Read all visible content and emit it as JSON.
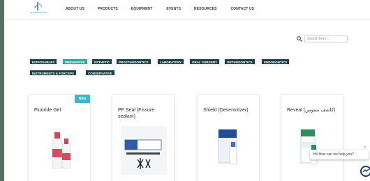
{
  "header": {
    "logo_text": "Al Hassan Dental",
    "nav": [
      "ABOUT US",
      "PRODUCTS",
      "EQUIPMENT",
      "EVENTS",
      "RESOURCES",
      "CONTACT US"
    ]
  },
  "search": {
    "placeholder": "Search here..."
  },
  "tabs": [
    "DISPOSABLES",
    "PREVENTIVE",
    "ESTHETIC",
    "PROSTHODONTICS",
    "LABORATORY",
    "ORAL SURGERY",
    "ORTHODONTICS",
    "ENDODONTICS",
    "INSTRUMENTS & FORCEPS",
    "CONSERVATIVE"
  ],
  "active_tab": "PREVENTIVE",
  "products": [
    {
      "title": "Fluoride Gel",
      "badge": "New"
    },
    {
      "title": "PF Seal (Fissure sealant)"
    },
    {
      "title": "Shield (Desensitizer)"
    },
    {
      "title": "Reveal (كاشف تسوس)"
    }
  ],
  "chat": {
    "prompt": "Hi! How can we help you?",
    "close": "×"
  },
  "colors": {
    "tab_bg": "#1c3f48",
    "tab_active": "#27ae9a",
    "badge": "#3fb7c9"
  }
}
